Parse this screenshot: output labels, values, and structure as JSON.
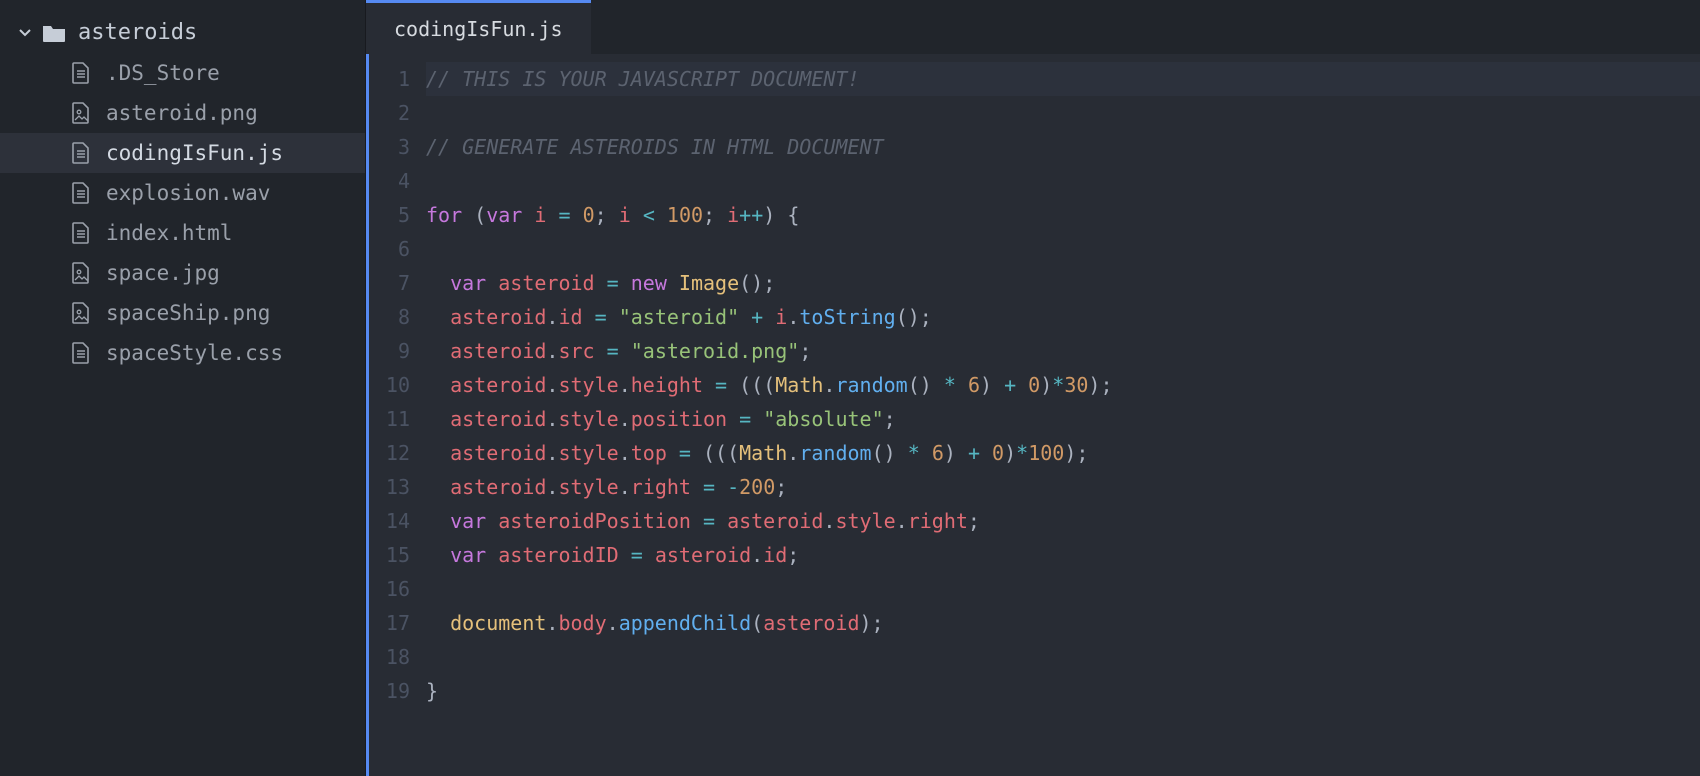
{
  "sidebar": {
    "folder_name": "asteroids",
    "files": [
      {
        "name": ".DS_Store",
        "icon": "file-text",
        "selected": false
      },
      {
        "name": "asteroid.png",
        "icon": "file-image",
        "selected": false
      },
      {
        "name": "codingIsFun.js",
        "icon": "file-text",
        "selected": true
      },
      {
        "name": "explosion.wav",
        "icon": "file-text",
        "selected": false
      },
      {
        "name": "index.html",
        "icon": "file-text",
        "selected": false
      },
      {
        "name": "space.jpg",
        "icon": "file-image",
        "selected": false
      },
      {
        "name": "spaceShip.png",
        "icon": "file-image",
        "selected": false
      },
      {
        "name": "spaceStyle.css",
        "icon": "file-text",
        "selected": false
      }
    ]
  },
  "tab": {
    "label": "codingIsFun.js"
  },
  "editor": {
    "highlighted_line": 1,
    "lines": [
      [
        {
          "t": "comment",
          "v": "// THIS IS YOUR JAVASCRIPT DOCUMENT!"
        }
      ],
      [],
      [
        {
          "t": "comment",
          "v": "// GENERATE ASTEROIDS IN HTML DOCUMENT"
        }
      ],
      [],
      [
        {
          "t": "keyword",
          "v": "for"
        },
        {
          "t": "punct",
          "v": " ("
        },
        {
          "t": "storage",
          "v": "var"
        },
        {
          "t": "punct",
          "v": " "
        },
        {
          "t": "ident",
          "v": "i"
        },
        {
          "t": "punct",
          "v": " "
        },
        {
          "t": "op",
          "v": "="
        },
        {
          "t": "punct",
          "v": " "
        },
        {
          "t": "num",
          "v": "0"
        },
        {
          "t": "punct",
          "v": "; "
        },
        {
          "t": "ident",
          "v": "i"
        },
        {
          "t": "punct",
          "v": " "
        },
        {
          "t": "op",
          "v": "<"
        },
        {
          "t": "punct",
          "v": " "
        },
        {
          "t": "num",
          "v": "100"
        },
        {
          "t": "punct",
          "v": "; "
        },
        {
          "t": "ident",
          "v": "i"
        },
        {
          "t": "op",
          "v": "++"
        },
        {
          "t": "punct",
          "v": ") {"
        }
      ],
      [],
      [
        {
          "t": "punct",
          "v": "  "
        },
        {
          "t": "storage",
          "v": "var"
        },
        {
          "t": "punct",
          "v": " "
        },
        {
          "t": "ident",
          "v": "asteroid"
        },
        {
          "t": "punct",
          "v": " "
        },
        {
          "t": "op",
          "v": "="
        },
        {
          "t": "punct",
          "v": " "
        },
        {
          "t": "keyword",
          "v": "new"
        },
        {
          "t": "punct",
          "v": " "
        },
        {
          "t": "builtin",
          "v": "Image"
        },
        {
          "t": "punct",
          "v": "();"
        }
      ],
      [
        {
          "t": "punct",
          "v": "  "
        },
        {
          "t": "ident",
          "v": "asteroid"
        },
        {
          "t": "punct",
          "v": "."
        },
        {
          "t": "prop",
          "v": "id"
        },
        {
          "t": "punct",
          "v": " "
        },
        {
          "t": "op",
          "v": "="
        },
        {
          "t": "punct",
          "v": " "
        },
        {
          "t": "string",
          "v": "\"asteroid\""
        },
        {
          "t": "punct",
          "v": " "
        },
        {
          "t": "op",
          "v": "+"
        },
        {
          "t": "punct",
          "v": " "
        },
        {
          "t": "ident",
          "v": "i"
        },
        {
          "t": "punct",
          "v": "."
        },
        {
          "t": "func",
          "v": "toString"
        },
        {
          "t": "punct",
          "v": "();"
        }
      ],
      [
        {
          "t": "punct",
          "v": "  "
        },
        {
          "t": "ident",
          "v": "asteroid"
        },
        {
          "t": "punct",
          "v": "."
        },
        {
          "t": "prop",
          "v": "src"
        },
        {
          "t": "punct",
          "v": " "
        },
        {
          "t": "op",
          "v": "="
        },
        {
          "t": "punct",
          "v": " "
        },
        {
          "t": "string",
          "v": "\"asteroid.png\""
        },
        {
          "t": "punct",
          "v": ";"
        }
      ],
      [
        {
          "t": "punct",
          "v": "  "
        },
        {
          "t": "ident",
          "v": "asteroid"
        },
        {
          "t": "punct",
          "v": "."
        },
        {
          "t": "prop",
          "v": "style"
        },
        {
          "t": "punct",
          "v": "."
        },
        {
          "t": "prop",
          "v": "height"
        },
        {
          "t": "punct",
          "v": " "
        },
        {
          "t": "op",
          "v": "="
        },
        {
          "t": "punct",
          "v": " ((("
        },
        {
          "t": "builtin",
          "v": "Math"
        },
        {
          "t": "punct",
          "v": "."
        },
        {
          "t": "func",
          "v": "random"
        },
        {
          "t": "punct",
          "v": "() "
        },
        {
          "t": "op",
          "v": "*"
        },
        {
          "t": "punct",
          "v": " "
        },
        {
          "t": "num",
          "v": "6"
        },
        {
          "t": "punct",
          "v": ") "
        },
        {
          "t": "op",
          "v": "+"
        },
        {
          "t": "punct",
          "v": " "
        },
        {
          "t": "num",
          "v": "0"
        },
        {
          "t": "punct",
          "v": ")"
        },
        {
          "t": "op",
          "v": "*"
        },
        {
          "t": "num",
          "v": "30"
        },
        {
          "t": "punct",
          "v": ");"
        }
      ],
      [
        {
          "t": "punct",
          "v": "  "
        },
        {
          "t": "ident",
          "v": "asteroid"
        },
        {
          "t": "punct",
          "v": "."
        },
        {
          "t": "prop",
          "v": "style"
        },
        {
          "t": "punct",
          "v": "."
        },
        {
          "t": "prop",
          "v": "position"
        },
        {
          "t": "punct",
          "v": " "
        },
        {
          "t": "op",
          "v": "="
        },
        {
          "t": "punct",
          "v": " "
        },
        {
          "t": "string",
          "v": "\"absolute\""
        },
        {
          "t": "punct",
          "v": ";"
        }
      ],
      [
        {
          "t": "punct",
          "v": "  "
        },
        {
          "t": "ident",
          "v": "asteroid"
        },
        {
          "t": "punct",
          "v": "."
        },
        {
          "t": "prop",
          "v": "style"
        },
        {
          "t": "punct",
          "v": "."
        },
        {
          "t": "prop",
          "v": "top"
        },
        {
          "t": "punct",
          "v": " "
        },
        {
          "t": "op",
          "v": "="
        },
        {
          "t": "punct",
          "v": " ((("
        },
        {
          "t": "builtin",
          "v": "Math"
        },
        {
          "t": "punct",
          "v": "."
        },
        {
          "t": "func",
          "v": "random"
        },
        {
          "t": "punct",
          "v": "() "
        },
        {
          "t": "op",
          "v": "*"
        },
        {
          "t": "punct",
          "v": " "
        },
        {
          "t": "num",
          "v": "6"
        },
        {
          "t": "punct",
          "v": ") "
        },
        {
          "t": "op",
          "v": "+"
        },
        {
          "t": "punct",
          "v": " "
        },
        {
          "t": "num",
          "v": "0"
        },
        {
          "t": "punct",
          "v": ")"
        },
        {
          "t": "op",
          "v": "*"
        },
        {
          "t": "num",
          "v": "100"
        },
        {
          "t": "punct",
          "v": ");"
        }
      ],
      [
        {
          "t": "punct",
          "v": "  "
        },
        {
          "t": "ident",
          "v": "asteroid"
        },
        {
          "t": "punct",
          "v": "."
        },
        {
          "t": "prop",
          "v": "style"
        },
        {
          "t": "punct",
          "v": "."
        },
        {
          "t": "prop",
          "v": "right"
        },
        {
          "t": "punct",
          "v": " "
        },
        {
          "t": "op",
          "v": "="
        },
        {
          "t": "punct",
          "v": " "
        },
        {
          "t": "op",
          "v": "-"
        },
        {
          "t": "num",
          "v": "200"
        },
        {
          "t": "punct",
          "v": ";"
        }
      ],
      [
        {
          "t": "punct",
          "v": "  "
        },
        {
          "t": "storage",
          "v": "var"
        },
        {
          "t": "punct",
          "v": " "
        },
        {
          "t": "ident",
          "v": "asteroidPosition"
        },
        {
          "t": "punct",
          "v": " "
        },
        {
          "t": "op",
          "v": "="
        },
        {
          "t": "punct",
          "v": " "
        },
        {
          "t": "ident",
          "v": "asteroid"
        },
        {
          "t": "punct",
          "v": "."
        },
        {
          "t": "prop",
          "v": "style"
        },
        {
          "t": "punct",
          "v": "."
        },
        {
          "t": "prop",
          "v": "right"
        },
        {
          "t": "punct",
          "v": ";"
        }
      ],
      [
        {
          "t": "punct",
          "v": "  "
        },
        {
          "t": "storage",
          "v": "var"
        },
        {
          "t": "punct",
          "v": " "
        },
        {
          "t": "ident",
          "v": "asteroidID"
        },
        {
          "t": "punct",
          "v": " "
        },
        {
          "t": "op",
          "v": "="
        },
        {
          "t": "punct",
          "v": " "
        },
        {
          "t": "ident",
          "v": "asteroid"
        },
        {
          "t": "punct",
          "v": "."
        },
        {
          "t": "prop",
          "v": "id"
        },
        {
          "t": "punct",
          "v": ";"
        }
      ],
      [],
      [
        {
          "t": "punct",
          "v": "  "
        },
        {
          "t": "builtin",
          "v": "document"
        },
        {
          "t": "punct",
          "v": "."
        },
        {
          "t": "prop",
          "v": "body"
        },
        {
          "t": "punct",
          "v": "."
        },
        {
          "t": "func",
          "v": "appendChild"
        },
        {
          "t": "punct",
          "v": "("
        },
        {
          "t": "ident",
          "v": "asteroid"
        },
        {
          "t": "punct",
          "v": ");"
        }
      ],
      [],
      [
        {
          "t": "punct",
          "v": "}"
        }
      ]
    ]
  }
}
